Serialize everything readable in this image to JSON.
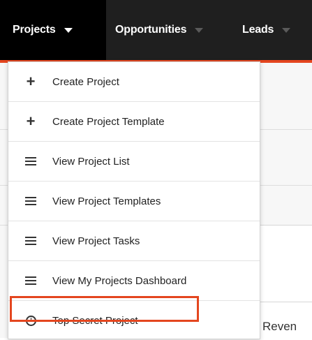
{
  "nav": {
    "tabs": [
      {
        "label": "Projects",
        "active": true
      },
      {
        "label": "Opportunities",
        "active": false
      },
      {
        "label": "Leads",
        "active": false
      }
    ]
  },
  "background": {
    "partial_text": "Reven"
  },
  "menu": {
    "items": [
      {
        "label": "Create Project",
        "icon": "plus-icon"
      },
      {
        "label": "Create Project Template",
        "icon": "plus-icon"
      },
      {
        "label": "View Project List",
        "icon": "list-icon"
      },
      {
        "label": "View Project Templates",
        "icon": "list-icon"
      },
      {
        "label": "View Project Tasks",
        "icon": "list-icon"
      },
      {
        "label": "View My Projects Dashboard",
        "icon": "list-icon"
      },
      {
        "label": "Top Secret Project",
        "icon": "clock-icon",
        "highlighted": true
      }
    ]
  },
  "colors": {
    "navbar": "#1f1f1f",
    "active_tab": "#000000",
    "accent": "#e4461f",
    "highlight_border": "#e4461f"
  }
}
